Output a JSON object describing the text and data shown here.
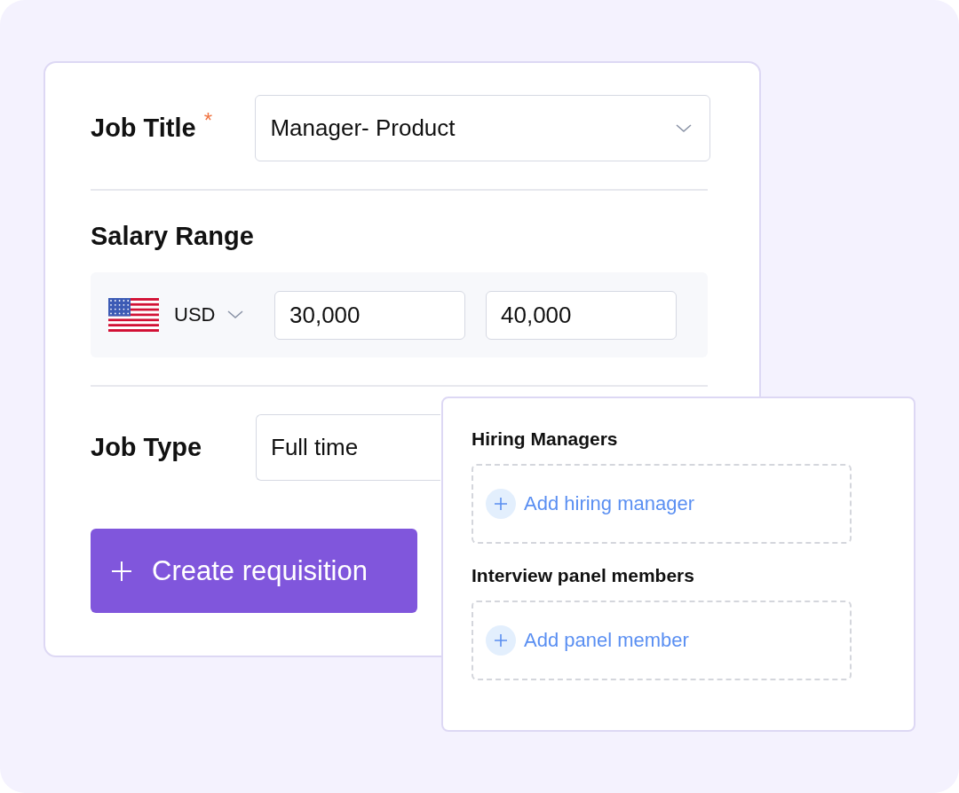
{
  "job_title": {
    "label": "Job Title",
    "required_mark": "*",
    "value": "Manager- Product"
  },
  "salary": {
    "label": "Salary Range",
    "currency": "USD",
    "min": "30,000",
    "max": "40,000"
  },
  "job_type": {
    "label": "Job Type",
    "value": "Full time"
  },
  "create_button": {
    "label": "Create requisition"
  },
  "panel": {
    "sections": [
      {
        "title": "Hiring Managers",
        "action": "Add hiring manager"
      },
      {
        "title": "Interview panel members",
        "action": "Add panel member"
      }
    ]
  }
}
